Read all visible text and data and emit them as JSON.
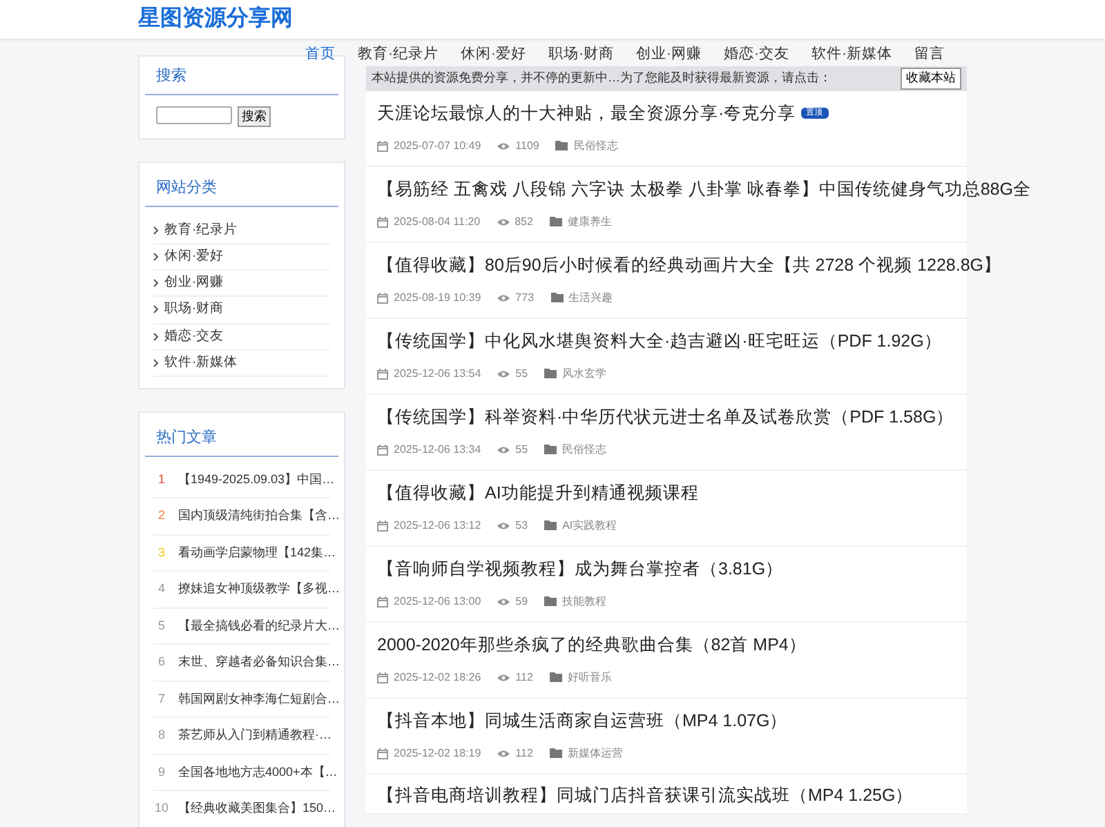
{
  "site_title": "星图资源分享网",
  "nav": [
    {
      "label": "首页",
      "selected": true
    },
    {
      "label": "教育·纪录片",
      "selected": false
    },
    {
      "label": "休闲·爱好",
      "selected": false
    },
    {
      "label": "职场·财商",
      "selected": false
    },
    {
      "label": "创业·网赚",
      "selected": false
    },
    {
      "label": "婚恋·交友",
      "selected": false
    },
    {
      "label": "软件·新媒体",
      "selected": false
    },
    {
      "label": "留言",
      "selected": false
    }
  ],
  "notice": {
    "text": "本站提供的资源免费分享，并不停的更新中…为了您能及时获得最新资源，请点击：",
    "button": "收藏本站"
  },
  "search_panel": {
    "title": "搜索",
    "button": "搜索"
  },
  "categories_panel": {
    "title": "网站分类",
    "items": [
      "教育·纪录片",
      "休闲·爱好",
      "创业·网赚",
      "职场·财商",
      "婚恋·交友",
      "软件·新媒体"
    ]
  },
  "hot_panel": {
    "title": "热门文章",
    "items": [
      {
        "rank": "1",
        "color": "#e74c3c",
        "title": "【1949-2025.09.03】中国…"
      },
      {
        "rank": "2",
        "color": "#f47c3c",
        "title": "国内顶级清纯街拍合集【含…"
      },
      {
        "rank": "3",
        "color": "#f5c518",
        "title": "看动画学启蒙物理【142集…"
      },
      {
        "rank": "4",
        "color": "#999999",
        "title": "撩妹追女神顶级教学【多视…"
      },
      {
        "rank": "5",
        "color": "#999999",
        "title": "【最全搞钱必看的纪录片大…"
      },
      {
        "rank": "6",
        "color": "#999999",
        "title": "末世、穿越者必备知识合集…"
      },
      {
        "rank": "7",
        "color": "#999999",
        "title": "韩国网剧女神李海仁短剧合…"
      },
      {
        "rank": "8",
        "color": "#999999",
        "title": "茶艺师从入门到精通教程·…"
      },
      {
        "rank": "9",
        "color": "#999999",
        "title": "全国各地地方志4000+本【…"
      },
      {
        "rank": "10",
        "color": "#999999",
        "title": "【经典收藏美图集合】150…"
      }
    ]
  },
  "posts": [
    {
      "title": "天涯论坛最惊人的十大神贴，最全资源分享·夸克分享",
      "badge": "置顶",
      "date": "2025-07-07 10:49",
      "views": "1109",
      "category": "民俗怪志"
    },
    {
      "title": "【易筋经 五禽戏 八段锦 六字诀 太极拳 八卦掌 咏春拳】中国传统健身气功总88G全",
      "date": "2025-08-04 11:20",
      "views": "852",
      "category": "健康养生"
    },
    {
      "title": "【值得收藏】80后90后小时候看的经典动画片大全【共 2728 个视频 1228.8G】",
      "date": "2025-08-19 10:39",
      "views": "773",
      "category": "生活兴趣"
    },
    {
      "title": "【传统国学】中化风水堪舆资料大全·趋吉避凶·旺宅旺运（PDF 1.92G）",
      "date": "2025-12-06 13:54",
      "views": "55",
      "category": "风水玄学"
    },
    {
      "title": "【传统国学】科举资料·中华历代状元进士名单及试卷欣赏（PDF 1.58G）",
      "date": "2025-12-06 13:34",
      "views": "55",
      "category": "民俗怪志"
    },
    {
      "title": "【值得收藏】AI功能提升到精通视频课程",
      "date": "2025-12-06 13:12",
      "views": "53",
      "category": "AI实践教程"
    },
    {
      "title": "【音响师自学视频教程】成为舞台掌控者（3.81G）",
      "date": "2025-12-06 13:00",
      "views": "59",
      "category": "技能教程"
    },
    {
      "title": "2000-2020年那些杀疯了的经典歌曲合集（82首 MP4）",
      "date": "2025-12-02 18:26",
      "views": "112",
      "category": "好听音乐"
    },
    {
      "title": "【抖音本地】同城生活商家自运营班（MP4 1.07G）",
      "date": "2025-12-02 18:19",
      "views": "112",
      "category": "新媒体运营"
    },
    {
      "title": "【抖音电商培训教程】同城门店抖音获课引流实战班（MP4 1.25G）"
    }
  ]
}
